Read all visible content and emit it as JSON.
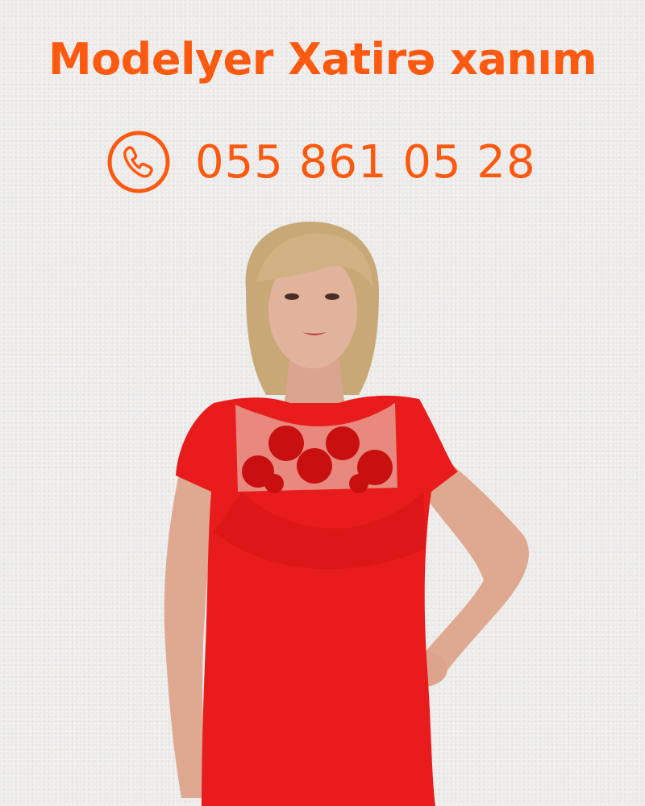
{
  "title": "Modelyer Xatirə xanım",
  "phone": {
    "icon": "phone-icon",
    "number": "055 861 05 28"
  },
  "photo": {
    "subject": "woman-in-red-dress-photo"
  },
  "colors": {
    "accent": "#ff5a10",
    "dress": "#e81c1c",
    "background": "#ecebea"
  }
}
